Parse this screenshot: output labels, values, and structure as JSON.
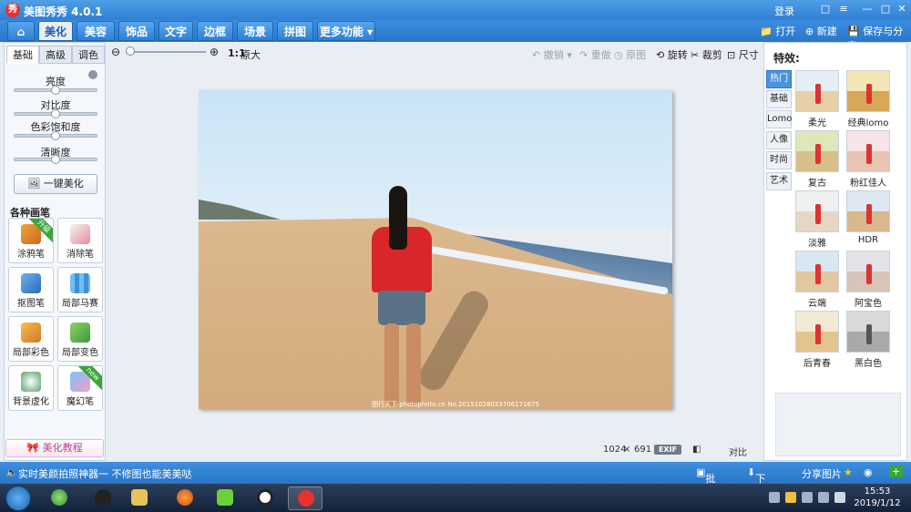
{
  "window": {
    "title": "美图秀秀 4.0.1",
    "login": "登录",
    "controls": [
      "□",
      "—",
      "□",
      "✕"
    ]
  },
  "tabs": [
    {
      "label": "⌂",
      "icon": "home-icon"
    },
    {
      "label": "美化",
      "active": true
    },
    {
      "label": "美容"
    },
    {
      "label": "饰品"
    },
    {
      "label": "文字"
    },
    {
      "label": "边框"
    },
    {
      "label": "场景"
    },
    {
      "label": "拼图"
    },
    {
      "label": "更多功能 ▾"
    }
  ],
  "toolbar_right": {
    "open": "打开",
    "new": "新建",
    "save": "保存与分享"
  },
  "left": {
    "subtabs": [
      "基础",
      "高级",
      "调色"
    ],
    "sliders": [
      {
        "label": "亮度",
        "value": 0.5
      },
      {
        "label": "对比度",
        "value": 0.5
      },
      {
        "label": "色彩饱和度",
        "value": 0.5
      },
      {
        "label": "清晰度",
        "value": 0.5
      }
    ],
    "onekey": "一键美化",
    "section": "各种画笔",
    "brushes": [
      {
        "label": "涂鸦笔",
        "badge": "升级"
      },
      {
        "label": "消除笔"
      },
      {
        "label": "抠图笔"
      },
      {
        "label": "局部马赛克"
      },
      {
        "label": "局部彩色笔"
      },
      {
        "label": "局部变色笔"
      },
      {
        "label": "背景虚化"
      },
      {
        "label": "魔幻笔",
        "badge": "new"
      }
    ],
    "tutorial": "美化教程"
  },
  "canvas": {
    "ratio": "1:1",
    "original": "原大",
    "undo": "撤销",
    "redo": "重做",
    "reset": "原图",
    "rotate": "旋转",
    "crop": "裁剪",
    "resize": "尺寸",
    "watermark": "图行天下 photophoto.cn  No.20151028023706171675",
    "width": "1024",
    "times": "×",
    "height": "691",
    "exif": "EXIF",
    "compare": "对比"
  },
  "right": {
    "title": "特效:",
    "categories": [
      "热门",
      "基础",
      "Lomo",
      "人像",
      "时尚",
      "艺术"
    ],
    "effects": [
      "柔光",
      "经典lomo",
      "复古",
      "粉红佳人",
      "淡雅",
      "HDR",
      "云端",
      "阿宝色",
      "后青春",
      "黑白色"
    ]
  },
  "statusbar": {
    "tip": "实时美颜拍照神器一 不修图也能美美哒",
    "batch": "批处理",
    "download": "下载管理",
    "share": "分享图片"
  },
  "taskbar": {
    "time": "15:53",
    "date": "2019/1/12",
    "apps": [
      "refresh-app",
      "qq-app",
      "explorer-app",
      "firefox-app",
      "video-app",
      "recorder-app",
      "meitu-app"
    ]
  },
  "colors": {
    "accent": "#2f7fd4",
    "active_tab_text": "#1a5fb0",
    "badge_green": "#3aa63a"
  }
}
